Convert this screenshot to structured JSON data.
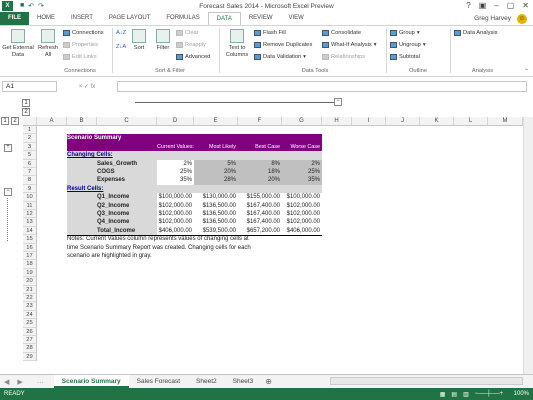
{
  "window": {
    "title": "Forecast Sales 2014 - Microsoft Excel Preview",
    "app_icon": "X"
  },
  "tabs": [
    "FILE",
    "HOME",
    "INSERT",
    "PAGE LAYOUT",
    "FORMULAS",
    "DATA",
    "REVIEW",
    "VIEW"
  ],
  "active_tab": "DATA",
  "user": {
    "name": "Greg Harvey"
  },
  "ribbon": {
    "get_external": "Get External Data",
    "refresh_all": "Refresh All",
    "connections": "Connections",
    "properties": "Properties",
    "edit_links": "Edit Links",
    "group_connections": "Connections",
    "sort_az": "A↓Z",
    "sort_za": "Z↓A",
    "sort": "Sort",
    "filter": "Filter",
    "clear": "Clear",
    "reapply": "Reapply",
    "advanced": "Advanced",
    "group_sortfilter": "Sort & Filter",
    "text_to_columns": "Text to Columns",
    "flash_fill": "Flash Fill",
    "remove_duplicates": "Remove Duplicates",
    "data_validation": "Data Validation",
    "consolidate": "Consolidate",
    "whatif": "What-If Analysis",
    "relationships": "Relationships",
    "group_datatools": "Data Tools",
    "group_btn": "Group",
    "ungroup_btn": "Ungroup",
    "subtotal": "Subtotal",
    "group_outline": "Outline",
    "data_analysis": "Data Analysis",
    "group_analysis": "Analysis"
  },
  "formula_bar": {
    "namebox": "A1",
    "fx": "× ✓ fx"
  },
  "outline_levels": [
    "1",
    "2"
  ],
  "columns": [
    "A",
    "B",
    "C",
    "D",
    "E",
    "F",
    "G",
    "H",
    "I",
    "J",
    "K",
    "L",
    "M"
  ],
  "rows": [
    "1",
    "2",
    "3",
    "5",
    "6",
    "7",
    "8",
    "9",
    "10",
    "11",
    "12",
    "13",
    "14",
    "15",
    "16",
    "17",
    "18",
    "19",
    "20",
    "21",
    "22",
    "23",
    "24",
    "25",
    "26",
    "27",
    "28",
    "29"
  ],
  "report": {
    "title": "Scenario Summary",
    "headers": [
      "Current Values:",
      "Most Likely",
      "Best Case",
      "Worse Case"
    ],
    "changing_label": "Changing Cells:",
    "changing": [
      {
        "name": "Sales_Growth",
        "values": [
          "2%",
          "5%",
          "8%",
          "2%"
        ]
      },
      {
        "name": "COGS",
        "values": [
          "25%",
          "20%",
          "18%",
          "25%"
        ]
      },
      {
        "name": "Expenses",
        "values": [
          "35%",
          "28%",
          "20%",
          "35%"
        ]
      }
    ],
    "result_label": "Result Cells:",
    "results": [
      {
        "name": "Q1_Income",
        "values": [
          "$100,000.00",
          "$130,000.00",
          "$155,000.00",
          "$100,000.00"
        ]
      },
      {
        "name": "Q2_Income",
        "values": [
          "$102,000.00",
          "$136,500.00",
          "$167,400.00",
          "$102,000.00"
        ]
      },
      {
        "name": "Q3_Income",
        "values": [
          "$102,000.00",
          "$136,500.00",
          "$167,400.00",
          "$102,000.00"
        ]
      },
      {
        "name": "Q4_Income",
        "values": [
          "$102,000.00",
          "$136,500.00",
          "$167,400.00",
          "$102,000.00"
        ]
      },
      {
        "name": "Total_Income",
        "values": [
          "$406,000.00",
          "$539,500.00",
          "$657,200.00",
          "$406,000.00"
        ]
      }
    ],
    "notes": [
      "Notes:  Current Values column represents values of changing cells at",
      "time Scenario Summary Report was created.  Changing cells for each",
      "scenario are highlighted in gray."
    ]
  },
  "sheets": [
    "Scenario Summary",
    "Sales Forecast",
    "Sheet2",
    "Sheet3"
  ],
  "active_sheet": "Scenario Summary",
  "status": {
    "ready": "READY",
    "zoom": "100%"
  }
}
